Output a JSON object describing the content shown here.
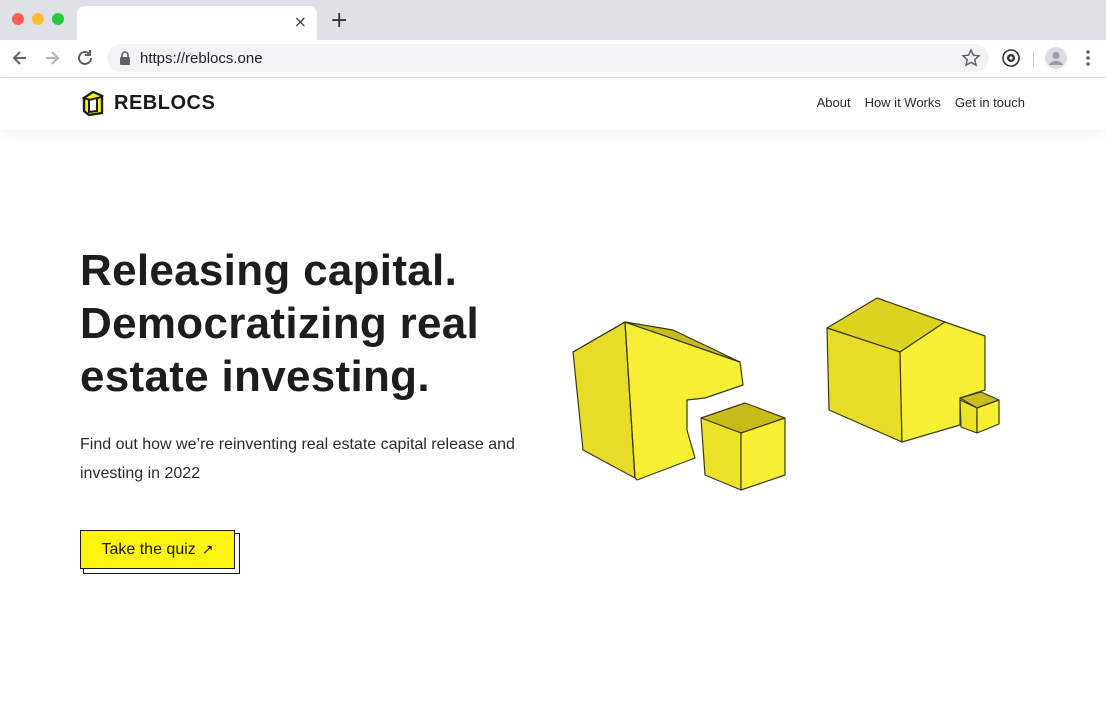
{
  "browser": {
    "url": "https://reblocs.one",
    "tab_close_glyph": "×",
    "new_tab_glyph": "+",
    "icons": [
      "back-icon",
      "forward-icon",
      "reload-icon",
      "lock-icon",
      "star-icon",
      "extension-icon",
      "profile-icon",
      "menu-icon"
    ]
  },
  "header": {
    "brand": "REBLOCS",
    "nav": [
      {
        "label": "About"
      },
      {
        "label": "How it Works"
      },
      {
        "label": "Get in touch"
      }
    ]
  },
  "hero": {
    "headline_lines": [
      "Releasing capital.",
      "Democratizing real",
      "estate investing."
    ],
    "subtext": "Find out how we’re reinventing real estate capital release and investing in 2022",
    "cta_label": "Take the quiz",
    "cta_icon": "↗"
  },
  "colors": {
    "accent_yellow": "#fff30f",
    "text_dark": "#1d1d1d",
    "chrome_bg": "#dee1e6"
  }
}
